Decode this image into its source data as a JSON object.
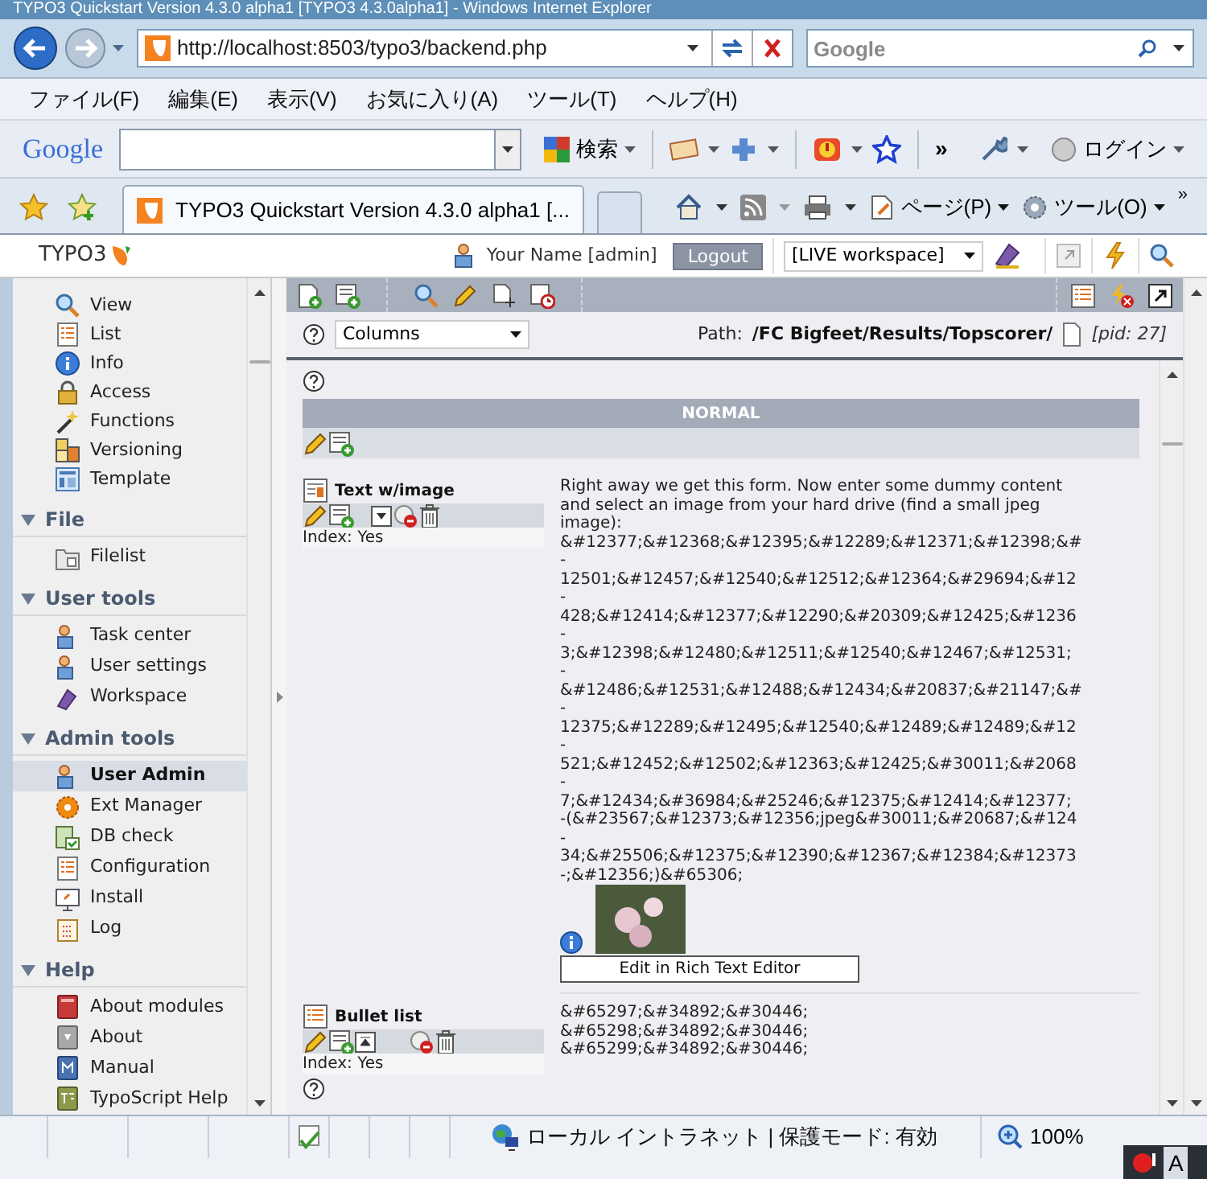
{
  "window": {
    "title": "TYPO3 Quickstart Version 4.3.0 alpha1 [TYPO3 4.3.0alpha1] - Windows Internet Explorer"
  },
  "address_bar": {
    "url": "http://localhost:8503/typo3/backend.php",
    "search_placeholder": "Google"
  },
  "menu_bar": [
    "ファイル(F)",
    "編集(E)",
    "表示(V)",
    "お気に入り(A)",
    "ツール(T)",
    "ヘルプ(H)"
  ],
  "google_toolbar": {
    "logo": "Google",
    "search_button": "検索",
    "more": "»",
    "login": "ログイン"
  },
  "tabs": [
    {
      "label": "TYPO3 Quickstart Version 4.3.0 alpha1 [...",
      "selected": true
    }
  ],
  "command_bar": {
    "page_menu": "ページ(P)",
    "tools_menu": "ツール(O)",
    "more": "»"
  },
  "typo3_header": {
    "logo": "TYPO3",
    "user": "Your Name [admin]",
    "logout": "Logout",
    "workspace": "[LIVE workspace]"
  },
  "sidebar": {
    "top_items": [
      {
        "label": "View",
        "kind": "mag",
        "selected": false
      },
      {
        "label": "List",
        "kind": "list",
        "selected": false
      },
      {
        "label": "Info",
        "kind": "info",
        "selected": false
      },
      {
        "label": "Access",
        "kind": "lock",
        "selected": false
      },
      {
        "label": "Functions",
        "kind": "wand",
        "selected": false
      },
      {
        "label": "Versioning",
        "kind": "version",
        "selected": false
      },
      {
        "label": "Template",
        "kind": "template",
        "selected": false
      }
    ],
    "groups": [
      {
        "title": "File",
        "expanded": true,
        "items": [
          {
            "label": "Filelist",
            "kind": "folder",
            "selected": false
          }
        ]
      },
      {
        "title": "User tools",
        "expanded": true,
        "items": [
          {
            "label": "Task center",
            "kind": "person",
            "selected": false
          },
          {
            "label": "User settings",
            "kind": "person",
            "selected": false
          },
          {
            "label": "Workspace",
            "kind": "workspace",
            "selected": false
          }
        ]
      },
      {
        "title": "Admin tools",
        "expanded": true,
        "items": [
          {
            "label": "User Admin",
            "kind": "person",
            "selected": true
          },
          {
            "label": "Ext Manager",
            "kind": "gear",
            "selected": false
          },
          {
            "label": "DB check",
            "kind": "db",
            "selected": false
          },
          {
            "label": "Configuration",
            "kind": "list",
            "selected": false
          },
          {
            "label": "Install",
            "kind": "monitor",
            "selected": false
          },
          {
            "label": "Log",
            "kind": "log",
            "selected": false
          }
        ]
      },
      {
        "title": "Help",
        "expanded": true,
        "items": [
          {
            "label": "About modules",
            "kind": "book_red",
            "selected": false
          },
          {
            "label": "About",
            "kind": "book_gray",
            "selected": false
          },
          {
            "label": "Manual",
            "kind": "book_blue",
            "selected": false
          },
          {
            "label": "TypoScript Help",
            "kind": "book_olive",
            "selected": false
          }
        ]
      }
    ]
  },
  "path_row": {
    "view_select": "Columns",
    "path_label": "Path:",
    "path": "/FC Bigfeet/Results/Topscorer/",
    "pid": "[pid: 27]"
  },
  "content": {
    "column_header": "NORMAL",
    "elements": [
      {
        "kind": "textpic",
        "title": "Text w/image",
        "index": "Index: Yes",
        "lines": [
          "Right away we get this form. Now enter some dummy content",
          "and select an image from your hard drive (find a small jpeg",
          "image):",
          "&#12377;&#12368;&#12395;&#12289;&#12371;&#12398;&#",
          "-",
          "12501;&#12457;&#12540;&#12512;&#12364;&#29694;&#12",
          "-",
          "428;&#12414;&#12377;&#12290;&#20309;&#12425;&#1236",
          "-",
          "3;&#12398;&#12480;&#12511;&#12540;&#12467;&#12531;",
          "-",
          "&#12486;&#12531;&#12488;&#12434;&#20837;&#21147;&#",
          "-",
          "12375;&#12289;&#12495;&#12540;&#12489;&#12489;&#12",
          "-",
          "521;&#12452;&#12502;&#12363;&#12425;&#30011;&#2068",
          "-",
          "7;&#12434;&#36984;&#25246;&#12375;&#12414;&#12377;",
          "-(&#23567;&#12373;&#12356;jpeg&#30011;&#20687;&#124",
          "-",
          "34;&#25506;&#12375;&#12390;&#12367;&#12384;&#12373",
          "-;&#12356;)&#65306;"
        ],
        "button": "Edit in Rich Text Editor"
      },
      {
        "kind": "bullets",
        "title": "Bullet list",
        "index": "Index: Yes",
        "lines": [
          "&#65297;&#34892;&#30446;",
          "&#65298;&#34892;&#30446;",
          "&#65299;&#34892;&#30446;"
        ]
      }
    ]
  },
  "status_bar": {
    "zone": "ローカル イントラネット | 保護モード: 有効",
    "zoom": "100%",
    "ime": "A"
  }
}
